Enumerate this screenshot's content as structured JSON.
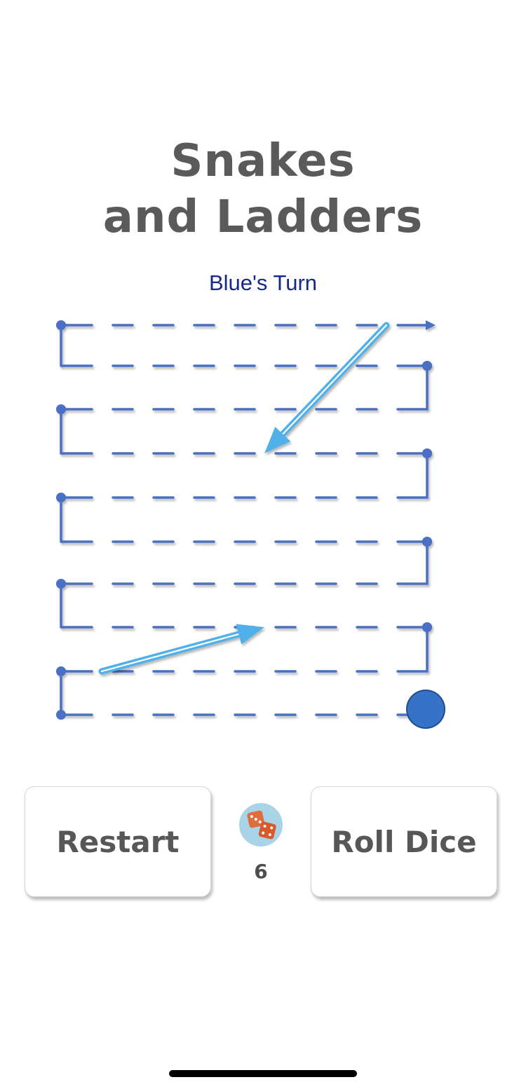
{
  "title": {
    "line1": "Snakes",
    "line2": "and Ladders"
  },
  "turn_text": "Blue's Turn",
  "board": {
    "rows": 10,
    "cols": 10,
    "path_color": "#4a6fc4",
    "ladder_color": "#4fb0ea",
    "ladders": [
      {
        "from_square": 12,
        "to_square": 25
      },
      {
        "from_square": 99,
        "to_square": 65
      }
    ]
  },
  "player": {
    "name": "Blue",
    "color": "#3673c7",
    "position_square": 1
  },
  "controls": {
    "restart_label": "Restart",
    "roll_label": "Roll Dice",
    "dice_icon": "dice-icon",
    "dice_value": "6"
  }
}
